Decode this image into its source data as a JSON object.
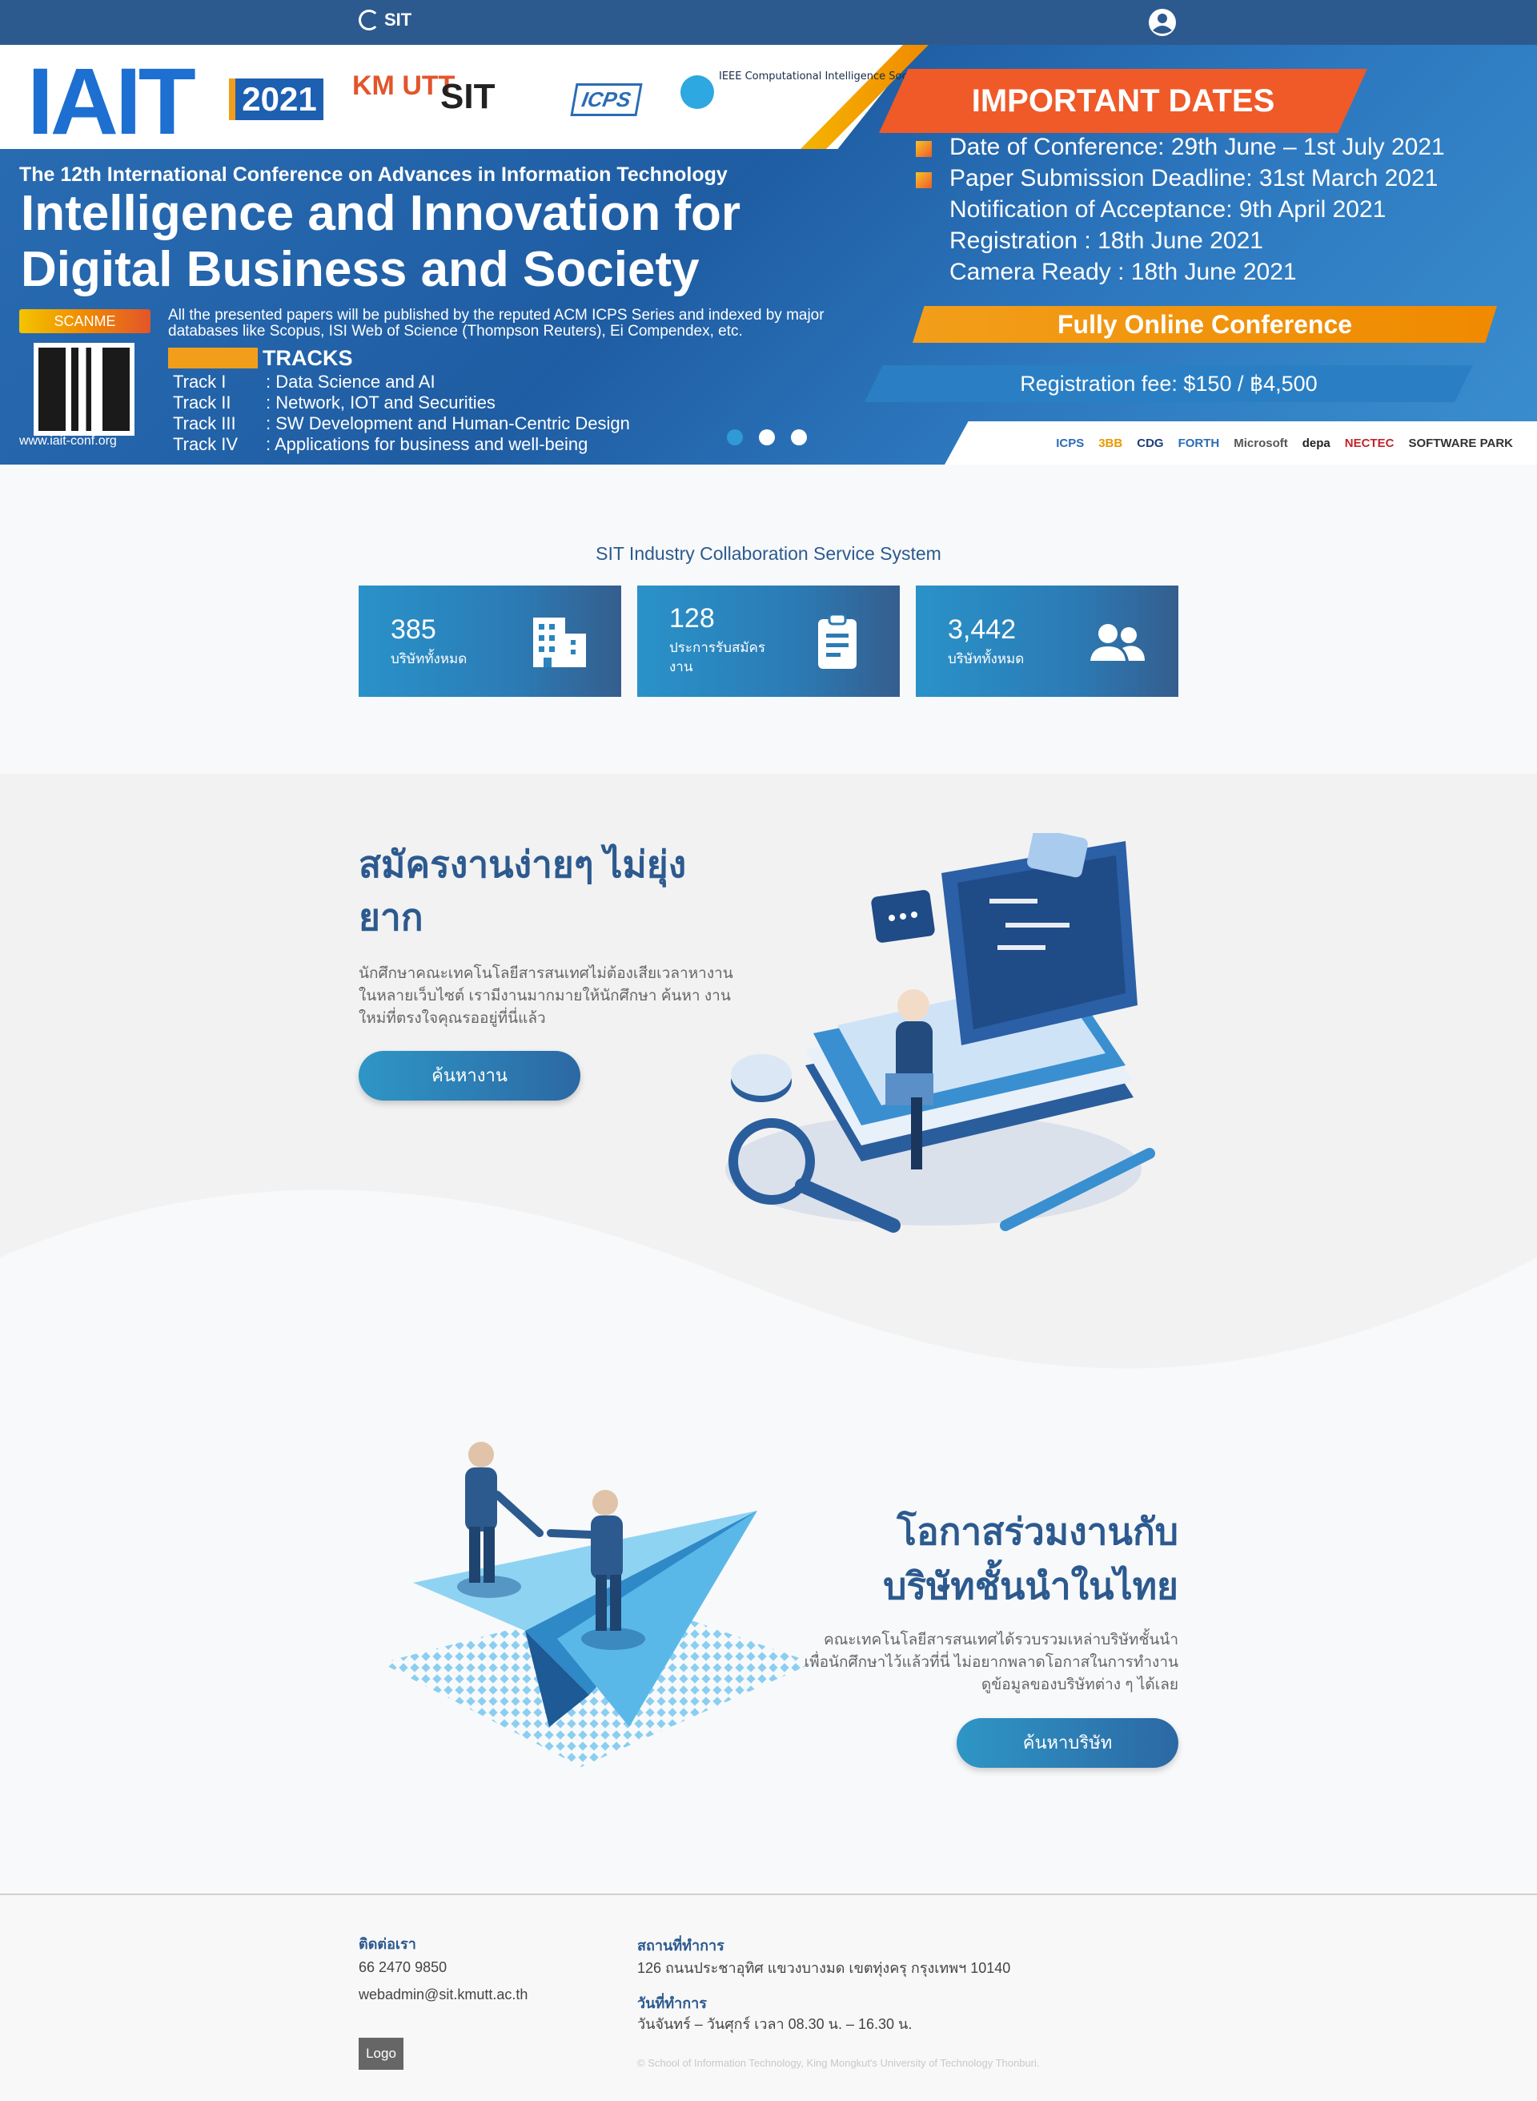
{
  "navbar": {
    "brand": "SIT"
  },
  "hero": {
    "logo": "IAIT",
    "year": "2021",
    "partners": {
      "kmutt": "KM UTT",
      "sit": "SIT",
      "icps": "ICPS",
      "ieee": "IEEE Computational Intelligence Society Thailand Chapter"
    },
    "conference_subtitle": "The 12th International Conference on Advances in Information Technology",
    "conference_title": "Intelligence and Innovation for Digital Business and Society",
    "scanme": "SCANME",
    "site_url": "www.iait-conf.org",
    "publish_note": "All the presented papers will be published by the reputed ACM ICPS Series and indexed by major databases like Scopus, ISI Web of Science (Thompson Reuters), Ei Compendex, etc.",
    "tracks_title": "TRACKS",
    "tracks": [
      {
        "name": "Track I",
        "topic": ": Data Science and AI"
      },
      {
        "name": "Track II",
        "topic": ": Network, IOT and Securities"
      },
      {
        "name": "Track III",
        "topic": ": SW Development and Human-Centric Design"
      },
      {
        "name": "Track IV",
        "topic": ": Applications for business and well-being"
      }
    ],
    "dates_header": "IMPORTANT DATES",
    "dates": [
      "Date of Conference: 29th June – 1st July 2021",
      "Paper Submission Deadline:  31st March 2021",
      "Notification of Acceptance: 9th April 2021",
      "Registration : 18th June 2021",
      "Camera Ready : 18th  June 2021"
    ],
    "online": "Fully Online Conference",
    "fee": "Registration fee:  $150 / ฿4,500",
    "sponsors": [
      "ICPS",
      "3BB",
      "CDG",
      "FORTH",
      "Microsoft",
      "depa",
      "NECTEC",
      "SOFTWARE PARK"
    ],
    "carousel_active": 1
  },
  "stats": {
    "title": "SIT Industry Collaboration Service System",
    "cards": [
      {
        "value": "385",
        "label": "บริษัททั้งหมด",
        "icon": "building-icon"
      },
      {
        "value": "128",
        "label": "ประการรับสมัครงาน",
        "icon": "clipboard-icon"
      },
      {
        "value": "3,442",
        "label": "บริษัททั้งหมด",
        "icon": "users-icon"
      }
    ]
  },
  "jobs": {
    "title": "สมัครงานง่ายๆ ไม่ยุ่งยาก",
    "description": "นักศึกษาคณะเทคโนโลยีสารสนเทศไม่ต้องเสียเวลาหางานในหลายเว็บไซต์ เรามีงานมากมายให้นักศึกษา ค้นหา งานใหม่ที่ตรงใจคุณรออยู่ที่นี่แล้ว",
    "button": "ค้นหางาน"
  },
  "companies": {
    "title": "โอกาสร่วมงานกับบริษัทชั้นนำในไทย",
    "description": "คณะเทคโนโลยีสารสนเทศได้รวบรวมเหล่าบริษัทชั้นนำเพื่อนักศึกษาไว้แล้วที่นี่ ไม่อยากพลาดโอกาสในการทำงาน ดูข้อมูลของบริษัทต่าง ๆ ได้เลย",
    "button": "ค้นหาบริษัท"
  },
  "footer": {
    "contact_label": "ติดต่อเรา",
    "phone": "66 2470 9850",
    "email": "webadmin@sit.kmutt.ac.th",
    "address_label": "สถานที่ทำการ",
    "address": "126 ถนนประชาอุทิศ แขวงบางมด เขตทุ่งครุ กรุงเทพฯ 10140",
    "hours_label": "วันที่ทำการ",
    "hours": "วันจันทร์ – วันศุกร์ เวลา 08.30 น. – 16.30 น.",
    "logo": "Logo",
    "copyright": "© School of Information Technology, King Mongkut's University of Technology Thonburi."
  }
}
